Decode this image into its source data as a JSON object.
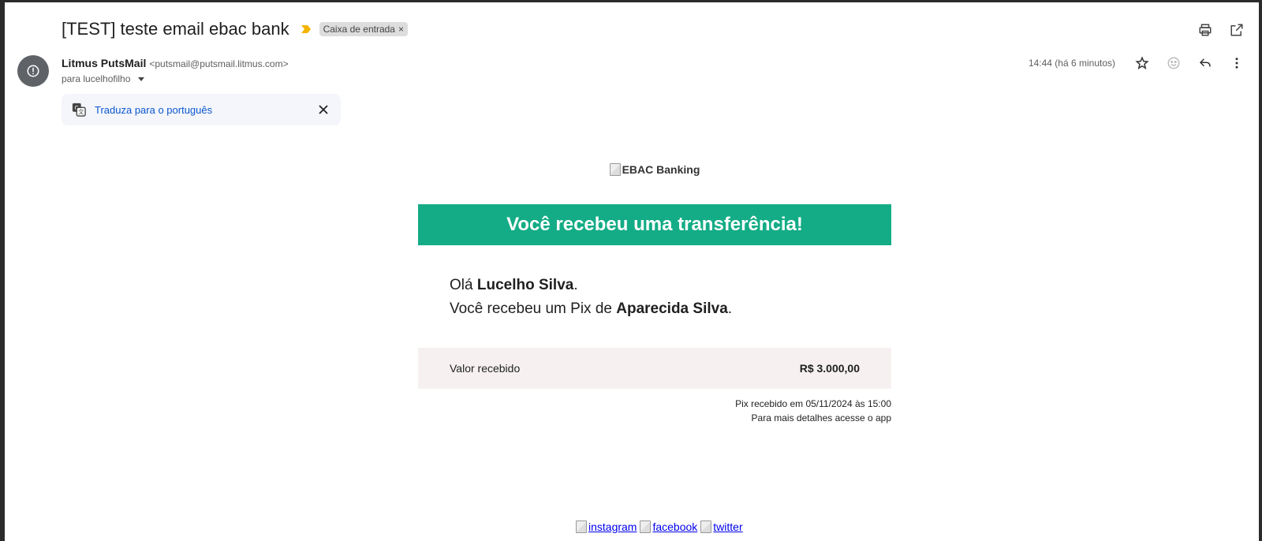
{
  "email": {
    "subject": "[TEST] teste email ebac bank",
    "label_chip": "Caixa de entrada",
    "sender_name": "Litmus PutsMail",
    "sender_email": "<putsmail@putsmail.litmus.com>",
    "recipient": "para lucelhofilho",
    "timestamp": "14:44 (há 6 minutos)"
  },
  "translate": {
    "link": "Traduza para o português"
  },
  "body": {
    "logo_alt": "EBAC Banking",
    "banner": "Você recebeu uma transferência!",
    "greeting_prefix": "Olá ",
    "recipient_name": "Lucelho Silva",
    "greeting_suffix": ".",
    "pix_prefix": "Você recebeu um Pix de ",
    "sender_name": "Aparecida Silva",
    "pix_suffix": ".",
    "amount_label": "Valor recebido",
    "amount_value": "R$ 3.000,00",
    "footnote_1": "Pix recebido em 05/11/2024 às 15:00",
    "footnote_2": "Para mais detalhes acesse o app"
  },
  "social": {
    "instagram": "instagram",
    "facebook": "facebook",
    "twitter": "twitter"
  },
  "colors": {
    "banner_green": "#13ac86",
    "link_blue": "#0b57d0",
    "amount_box_bg": "#f6f1f0"
  },
  "icons": {
    "important": "important-marker-icon",
    "print": "print-icon",
    "open_new_window": "open-in-new-icon",
    "avatar": "alert-circle-icon",
    "star": "star-icon",
    "emoji": "emoji-icon",
    "reply": "reply-icon",
    "more": "more-vert-icon",
    "translate": "translate-icon",
    "close": "close-icon"
  }
}
